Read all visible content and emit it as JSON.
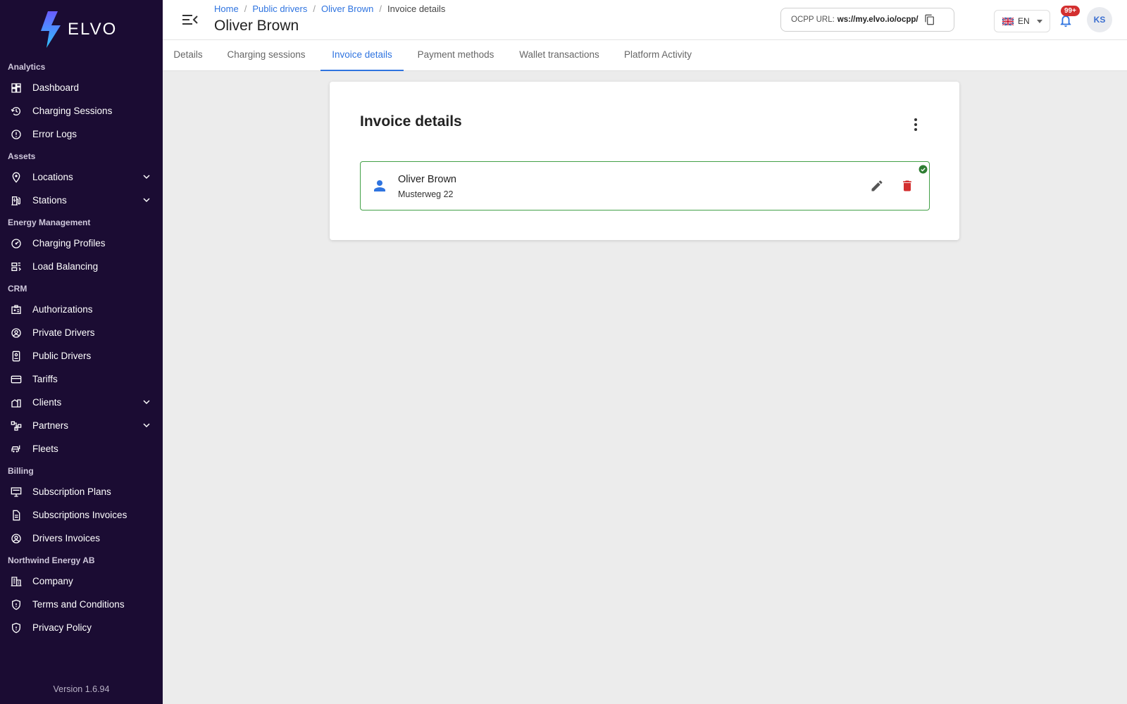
{
  "brand": {
    "name": "ELVO"
  },
  "sidebar": {
    "sections": [
      {
        "title": "Analytics",
        "items": [
          {
            "label": "Dashboard",
            "icon": "dashboard-icon",
            "chevron": false
          },
          {
            "label": "Charging Sessions",
            "icon": "history-icon",
            "chevron": false
          },
          {
            "label": "Error Logs",
            "icon": "alert-circle-icon",
            "chevron": false
          }
        ]
      },
      {
        "title": "Assets",
        "items": [
          {
            "label": "Locations",
            "icon": "location-pin-icon",
            "chevron": true
          },
          {
            "label": "Stations",
            "icon": "ev-station-icon",
            "chevron": true
          }
        ]
      },
      {
        "title": "Energy Management",
        "items": [
          {
            "label": "Charging Profiles",
            "icon": "gauge-icon",
            "chevron": false
          },
          {
            "label": "Load Balancing",
            "icon": "load-balance-icon",
            "chevron": false
          }
        ]
      },
      {
        "title": "CRM",
        "items": [
          {
            "label": "Authorizations",
            "icon": "badge-id-icon",
            "chevron": false
          },
          {
            "label": "Private Drivers",
            "icon": "user-circle-icon",
            "chevron": false
          },
          {
            "label": "Public Drivers",
            "icon": "user-card-icon",
            "chevron": false
          },
          {
            "label": "Tariffs",
            "icon": "credit-card-icon",
            "chevron": false
          },
          {
            "label": "Clients",
            "icon": "building-icon",
            "chevron": true
          },
          {
            "label": "Partners",
            "icon": "network-icon",
            "chevron": true
          },
          {
            "label": "Fleets",
            "icon": "car-icon",
            "chevron": false
          }
        ]
      },
      {
        "title": "Billing",
        "items": [
          {
            "label": "Subscription Plans",
            "icon": "monitor-icon",
            "chevron": false
          },
          {
            "label": "Subscriptions Invoices",
            "icon": "document-icon",
            "chevron": false
          },
          {
            "label": "Drivers Invoices",
            "icon": "user-circle-icon",
            "chevron": false
          }
        ]
      },
      {
        "title": "Northwind Energy AB",
        "items": [
          {
            "label": "Company",
            "icon": "company-icon",
            "chevron": false
          },
          {
            "label": "Terms and Conditions",
            "icon": "shield-icon",
            "chevron": false
          },
          {
            "label": "Privacy Policy",
            "icon": "shield-icon",
            "chevron": false
          }
        ]
      }
    ],
    "version": "Version 1.6.94"
  },
  "header": {
    "breadcrumb": {
      "home": "Home",
      "public_drivers": "Public drivers",
      "driver": "Oliver Brown",
      "current": "Invoice details"
    },
    "title": "Oliver Brown",
    "ocpp_label": "OCPP URL:",
    "ocpp_value": "ws://my.elvo.io/ocpp/",
    "language": "EN",
    "notification_count": "99+",
    "avatar_initials": "KS"
  },
  "tabs": [
    "Details",
    "Charging sessions",
    "Invoice details",
    "Payment methods",
    "Wallet transactions",
    "Platform Activity"
  ],
  "active_tab": "Invoice details",
  "card": {
    "title": "Invoice details",
    "entry": {
      "name": "Oliver Brown",
      "address": "Musterweg 22",
      "status": "verified"
    }
  },
  "colors": {
    "sidebar_bg": "#1b0c33",
    "accent": "#2f74e0",
    "success": "#43a047",
    "danger": "#d32f2f",
    "badge": "#d32f2f"
  }
}
